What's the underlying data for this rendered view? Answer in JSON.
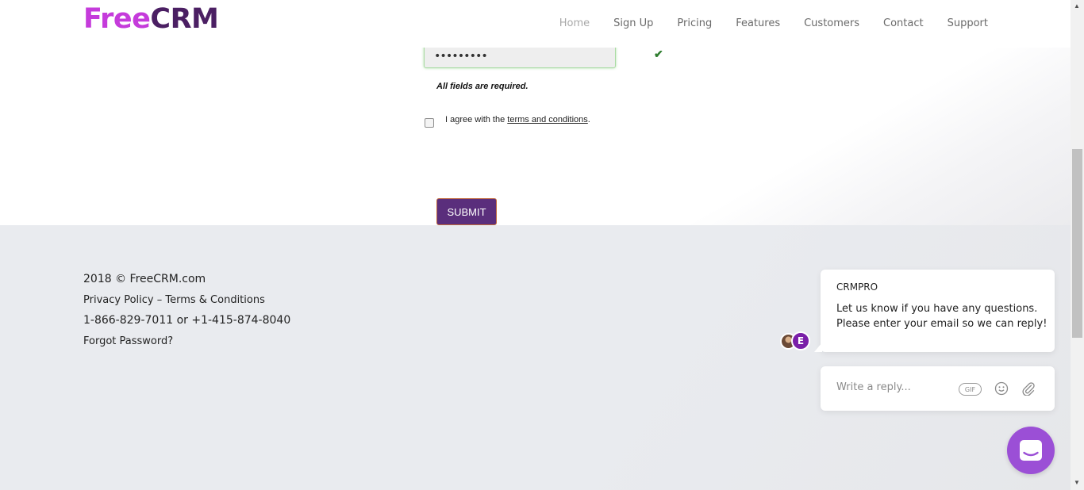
{
  "header": {
    "logo": {
      "part1": "Free",
      "part2": "CRM"
    },
    "nav": [
      {
        "label": "Home",
        "id": "home"
      },
      {
        "label": "Sign Up",
        "id": "sign-up"
      },
      {
        "label": "Pricing",
        "id": "pricing"
      },
      {
        "label": "Features",
        "id": "features"
      },
      {
        "label": "Customers",
        "id": "customers"
      },
      {
        "label": "Contact",
        "id": "contact"
      },
      {
        "label": "Support",
        "id": "support"
      }
    ]
  },
  "form": {
    "password_value": "•••••••••",
    "required_note": "All fields are required.",
    "agree_prefix": "I agree with the ",
    "agree_link": "terms and conditions",
    "agree_suffix": ".",
    "agree_checked": false,
    "submit_label": "SUBMIT"
  },
  "footer": {
    "copyright": "2018 © FreeCRM.com",
    "policy": "Privacy Policy – Terms & Conditions",
    "phones": "1-866-829-7011 or +1-415-874-8040",
    "forgot": "Forgot Password?"
  },
  "chat": {
    "sender": "CRMPRO",
    "message": "Let us know if you have any questions. Please enter your email so we can reply!",
    "avatar_initial": "E",
    "reply_placeholder": "Write a reply...",
    "gif_label": "GIF"
  },
  "colors": {
    "logo_free": "#c53bdb",
    "logo_crm": "#4b1f63",
    "submit_bg": "#5a2e7c",
    "launcher": "#9b4fd6",
    "avatar_e": "#7a1fa8",
    "footer_bg": "#e9ebef"
  }
}
